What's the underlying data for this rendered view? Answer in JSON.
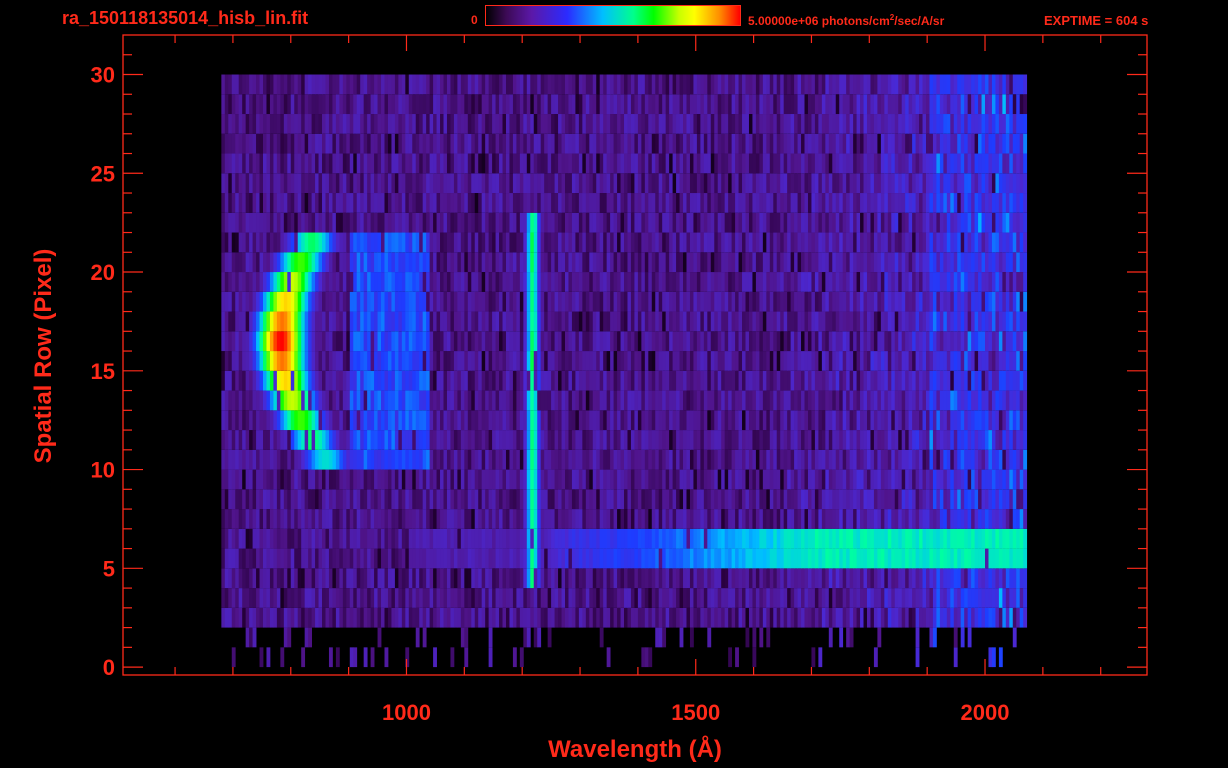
{
  "header": {
    "file_title": "ra_150118135014_hisb_lin.fit",
    "colorbar_min": "0",
    "colorbar_max_value": "5.00000e+06 photons/cm",
    "colorbar_max_exp": "2",
    "colorbar_max_units": "/sec/A/sr",
    "exptime": "EXPTIME = 604 s"
  },
  "colors": {
    "background": "#000000",
    "axis_text": "#ff2a1a"
  },
  "chart_data": {
    "type": "heatmap",
    "xlabel": "Wavelength (Å)",
    "ylabel": "Spatial Row (Pixel)",
    "xlim": [
      510,
      2280
    ],
    "ylim": [
      -0.4,
      32
    ],
    "x_ticks": [
      1000,
      1500,
      2000
    ],
    "y_ticks": [
      0,
      5,
      10,
      15,
      20,
      25,
      30
    ],
    "grid": false,
    "colorbar": {
      "min": 0,
      "max": 5000000,
      "units": "photons/cm^2/sec/A/sr",
      "colormap": "rainbow"
    },
    "row_count": 30,
    "detector_x_range": [
      680,
      2070
    ],
    "features": [
      {
        "label": "arc-shaped bright emission",
        "x_center": 820,
        "rows": [
          11,
          22
        ],
        "peak_rows": [
          14,
          19
        ],
        "peak_intensity": 5000000
      },
      {
        "label": "narrow vertical emission line",
        "x_center": 1215,
        "rows": [
          5,
          23
        ],
        "peak_intensity": 2800000
      },
      {
        "label": "bright horizontal band",
        "x_range": [
          1700,
          2070
        ],
        "rows": [
          6,
          7
        ],
        "peak_intensity": 2500000
      }
    ]
  }
}
